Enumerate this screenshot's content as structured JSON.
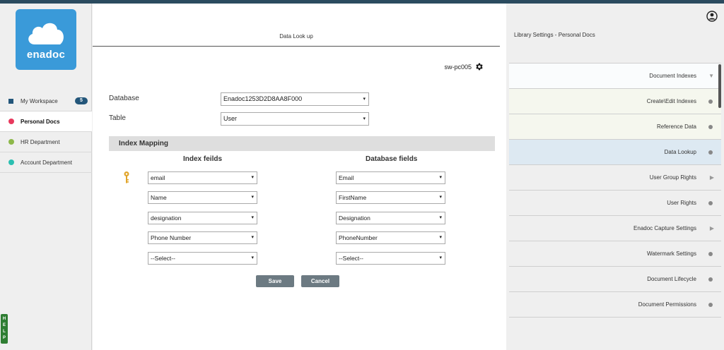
{
  "brand": {
    "logo_text": "enadoc"
  },
  "sidebar": {
    "items": [
      {
        "label": "My Workspace",
        "badge": "5",
        "marker": "square",
        "color": "#23567a"
      },
      {
        "label": "Personal Docs",
        "marker": "dot",
        "color": "#e8395d",
        "active": true
      },
      {
        "label": "HR Department",
        "marker": "dot",
        "color": "#8db84a"
      },
      {
        "label": "Account Department",
        "marker": "dot",
        "color": "#2bbfb1"
      }
    ],
    "help_letters": [
      "H",
      "E",
      "L",
      "P"
    ]
  },
  "main": {
    "title": "Data Look up",
    "machine": {
      "name": "sw-pc005",
      "icon": "gear-icon"
    },
    "database_label": "Database",
    "database_value": "Enadoc1253D2D8AA8F000",
    "table_label": "Table",
    "table_value": "User",
    "mapping_title": "Index Mapping",
    "index_fields_header": "Index feilds",
    "database_fields_header": "Database fields",
    "rows": [
      {
        "index": "email",
        "db": "Email",
        "key": true
      },
      {
        "index": "Name",
        "db": "FirstName"
      },
      {
        "index": "designation",
        "db": "Designation"
      },
      {
        "index": "Phone Number",
        "db": "PhoneNumber"
      },
      {
        "index": "--Select--",
        "db": "--Select--"
      }
    ],
    "save_label": "Save",
    "cancel_label": "Cancel",
    "caret": "▾"
  },
  "right": {
    "title": "Library Settings - Personal Docs",
    "menu": [
      {
        "label": "Document Indexes",
        "indicator": "filter",
        "style": "first"
      },
      {
        "label": "Create\\Edit Indexes",
        "indicator": "dot",
        "style": "light"
      },
      {
        "label": "Reference Data",
        "indicator": "dot",
        "style": "light"
      },
      {
        "label": "Data Lookup",
        "indicator": "dot",
        "style": "active"
      },
      {
        "label": "User Group Rights",
        "indicator": "arrow"
      },
      {
        "label": "User Rights",
        "indicator": "dot"
      },
      {
        "label": "Enadoc Capture Settings",
        "indicator": "arrow"
      },
      {
        "label": "Watermark Settings",
        "indicator": "dot"
      },
      {
        "label": "Document Lifecycle",
        "indicator": "dot"
      },
      {
        "label": "Document Permissions",
        "indicator": "dot"
      }
    ]
  }
}
